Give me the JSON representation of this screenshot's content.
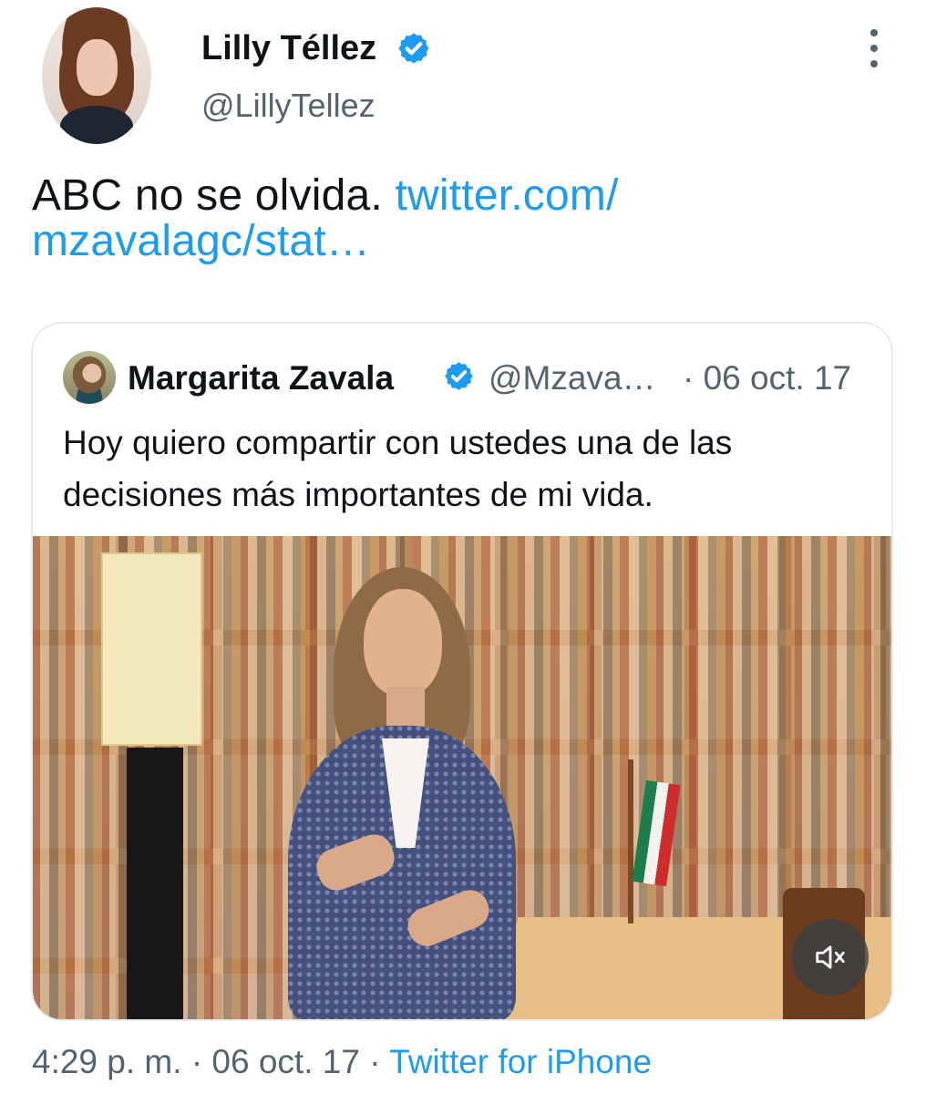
{
  "tweet": {
    "author_name": "Lilly Téllez",
    "author_handle": "@LillyTellez",
    "text_prefix": "ABC no se olvida. ",
    "link_text": "twitter.com/\nmzavalagc/stat…",
    "timestamp": "4:29 p. m.",
    "date": "06 oct. 17",
    "source": "Twitter for iPhone",
    "separator": "·"
  },
  "quoted_tweet": {
    "author_name": "Margarita Zavala",
    "author_handle": "@Mzava…",
    "date": "· 06 oct. 17",
    "text": "Hoy quiero compartir con ustedes una de las decisiones más importantes de mi vida."
  },
  "icons": {
    "verified": "verified-badge-icon",
    "more": "more-options-icon",
    "mute": "muted-speaker-icon"
  },
  "colors": {
    "link": "#1d9bf0",
    "secondary_text": "#536471",
    "primary_text": "#0f1419",
    "border": "#e6ecf0"
  }
}
